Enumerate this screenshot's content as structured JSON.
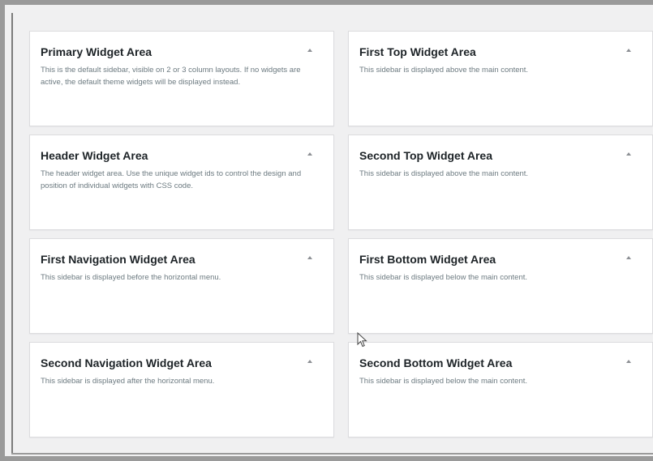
{
  "widget_areas": [
    {
      "title": "Primary Widget Area",
      "description": "This is the default sidebar, visible on 2 or 3 column layouts. If no widgets are active, the default theme widgets will be displayed instead."
    },
    {
      "title": "First Top Widget Area",
      "description": "This sidebar is displayed above the main content."
    },
    {
      "title": "Header Widget Area",
      "description": "The header widget area. Use the unique widget ids to control the design and position of individual widgets with CSS code."
    },
    {
      "title": "Second Top Widget Area",
      "description": "This sidebar is displayed above the main content."
    },
    {
      "title": "First Navigation Widget Area",
      "description": "This sidebar is displayed before the horizontal menu."
    },
    {
      "title": "First Bottom Widget Area",
      "description": "This sidebar is displayed below the main content."
    },
    {
      "title": "Second Navigation Widget Area",
      "description": "This sidebar is displayed after the horizontal menu."
    },
    {
      "title": "Second Bottom Widget Area",
      "description": "This sidebar is displayed below the main content."
    }
  ],
  "icons": {
    "toggle": "collapse-arrow-icon",
    "pointer": "mouse-cursor-icon"
  },
  "colors": {
    "background": "#f0f0f1",
    "card": "#ffffff",
    "title": "#1d2327",
    "description": "#6c7a80",
    "frame": "#9a9a9a"
  }
}
